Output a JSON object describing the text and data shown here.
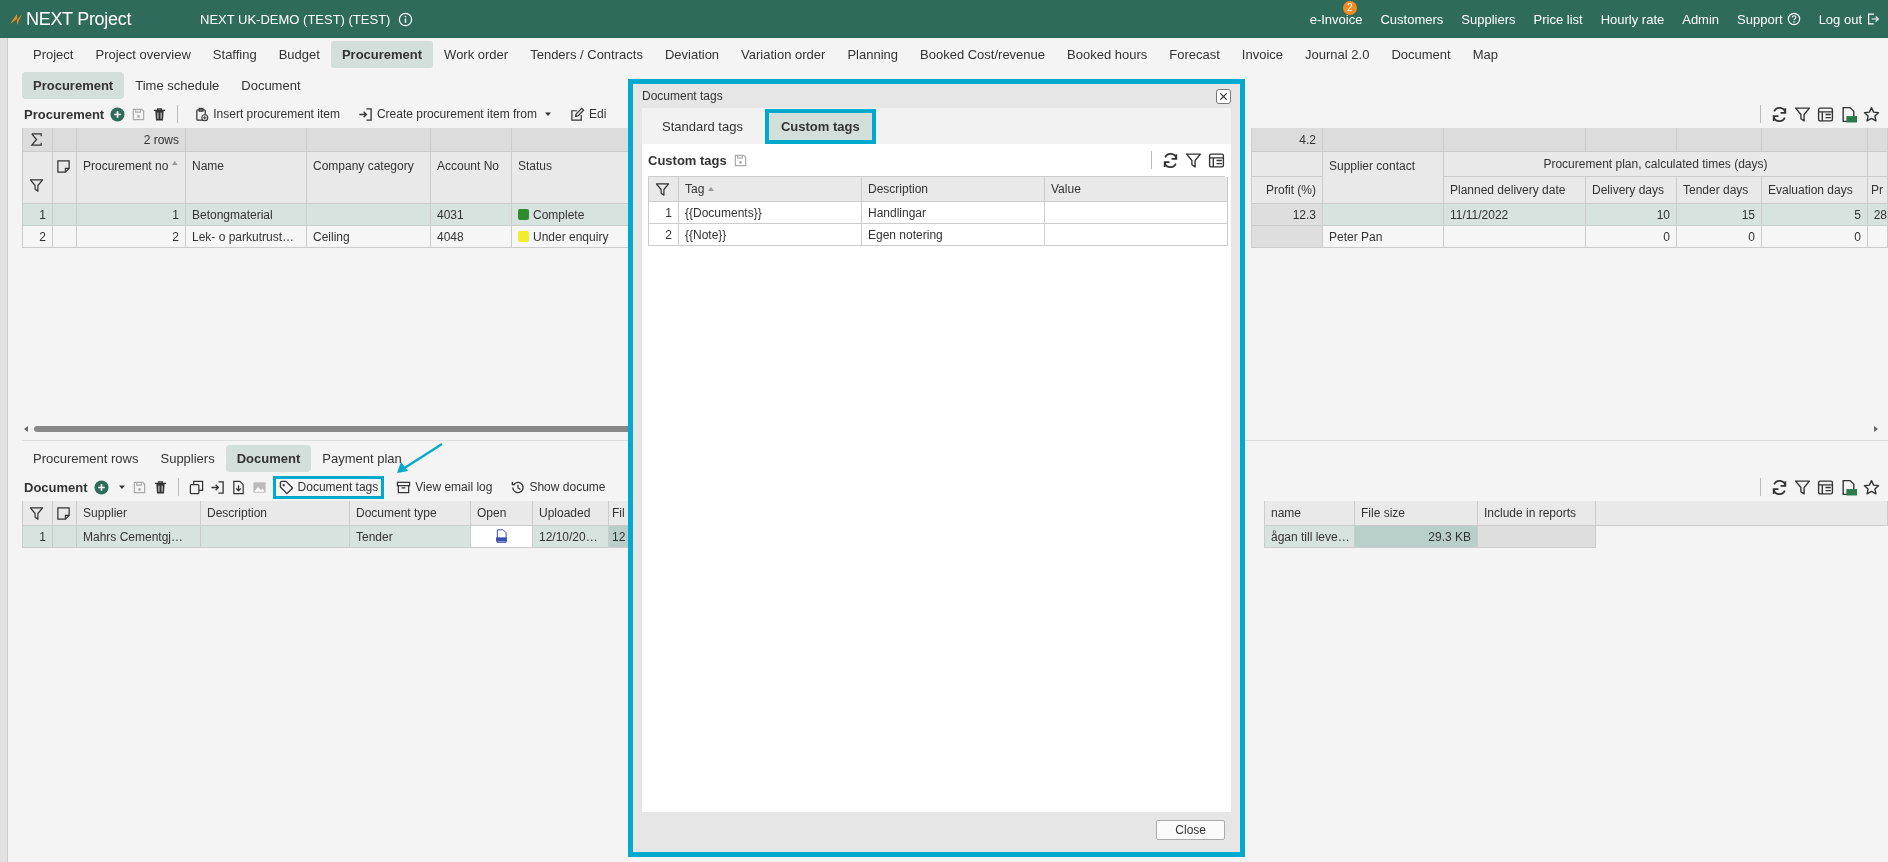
{
  "header": {
    "logo": "NEXT Project",
    "project": "NEXT UK-DEMO (TEST) (TEST)"
  },
  "top_nav": [
    {
      "label": "e-Invoice",
      "kind": "link",
      "badge": "2"
    },
    {
      "label": "Customers",
      "kind": "link"
    },
    {
      "label": "Suppliers",
      "kind": "link"
    },
    {
      "label": "Price list",
      "kind": "link"
    },
    {
      "label": "Hourly rate",
      "kind": "link"
    },
    {
      "label": "Admin",
      "kind": "link"
    },
    {
      "label": "Support",
      "kind": "help"
    },
    {
      "label": "Log out",
      "kind": "logout"
    }
  ],
  "main_tabs": [
    {
      "label": "Project",
      "selected": false
    },
    {
      "label": "Project overview",
      "selected": false
    },
    {
      "label": "Staffing",
      "selected": false
    },
    {
      "label": "Budget",
      "selected": false
    },
    {
      "label": "Procurement",
      "selected": true
    },
    {
      "label": "Work order",
      "selected": false
    },
    {
      "label": "Tenders / Contracts",
      "selected": false
    },
    {
      "label": "Deviation",
      "selected": false
    },
    {
      "label": "Variation order",
      "selected": false
    },
    {
      "label": "Planning",
      "selected": false
    },
    {
      "label": "Booked Cost/revenue",
      "selected": false
    },
    {
      "label": "Booked hours",
      "selected": false
    },
    {
      "label": "Forecast",
      "selected": false
    },
    {
      "label": "Invoice",
      "selected": false
    },
    {
      "label": "Journal 2.0",
      "selected": false
    },
    {
      "label": "Document",
      "selected": false
    },
    {
      "label": "Map",
      "selected": false
    }
  ],
  "sub_tabs": [
    {
      "label": "Procurement",
      "selected": true
    },
    {
      "label": "Time schedule",
      "selected": false
    },
    {
      "label": "Document",
      "selected": false
    }
  ],
  "procurement": {
    "title": "Procurement",
    "actions": [
      {
        "label": "Insert procurement item",
        "kind": "insert",
        "dropdown": false
      },
      {
        "label": "Create procurement item from",
        "kind": "create",
        "dropdown": true
      },
      {
        "label": "Edi",
        "kind": "edit",
        "dropdown": false
      }
    ]
  },
  "procurement_table": {
    "summary": "2 rows",
    "right_summary": "4.2",
    "columns": [
      {
        "label": "Procurement no",
        "sorted": true
      },
      {
        "label": "Name",
        "sorted": false
      },
      {
        "label": "Company category",
        "sorted": false
      },
      {
        "label": "Account No",
        "sorted": false
      },
      {
        "label": "Status",
        "sorted": false
      }
    ],
    "right_columns": {
      "column_1": "Profit (%)",
      "supplier_contact": "Supplier contact",
      "group": "Procurement plan, calculated times (days)",
      "group_columns": [
        "Planned delivery date",
        "Delivery days",
        "Tender days",
        "Evaluation days"
      ],
      "column_last": "Pr"
    },
    "rows": [
      {
        "no": "1",
        "selected": true,
        "cells": [
          "1",
          "Betongmaterial",
          "",
          "4031"
        ],
        "status": {
          "label": "Complete",
          "color": "#2e8b2e"
        },
        "right_cells": [
          "12.3",
          "",
          "11/11/2022",
          "10",
          "15",
          "5",
          "28"
        ]
      },
      {
        "no": "2",
        "selected": false,
        "cells": [
          "2",
          "Lek- o parkutrust…",
          "Ceiling",
          "4048"
        ],
        "status": {
          "label": "Under enquiry",
          "color": "#f2ec2e"
        },
        "right_cells": [
          "",
          "Peter Pan",
          "",
          "0",
          "0",
          "0",
          ""
        ]
      }
    ]
  },
  "bottom_tabs": [
    {
      "label": "Procurement rows",
      "selected": false
    },
    {
      "label": "Suppliers",
      "selected": false
    },
    {
      "label": "Document",
      "selected": true
    },
    {
      "label": "Payment plan",
      "selected": false
    }
  ],
  "document": {
    "title": "Document",
    "actions": [
      {
        "label": "Document tags",
        "kind": "tag",
        "highlighted": true
      },
      {
        "label": "View email log",
        "kind": "archive",
        "highlighted": false
      },
      {
        "label": "Show docume",
        "kind": "history",
        "highlighted": false
      }
    ]
  },
  "document_table": {
    "columns": [
      "Supplier",
      "Description",
      "Document type",
      "Open",
      "Uploaded",
      "Fil"
    ],
    "right_columns": [
      "name",
      "File size",
      "Include in reports"
    ],
    "rows": [
      {
        "no": "1",
        "selected": true,
        "cells": [
          "Mahrs Cementgj…",
          "",
          "Tender",
          "",
          "12/10/20…",
          "12"
        ],
        "right_cells": [
          "ågan till leve…",
          "29.3 KB",
          ""
        ]
      }
    ]
  },
  "dialog": {
    "title": "Document tags",
    "highlighted": true,
    "tabs": [
      {
        "label": "Standard tags",
        "selected": false,
        "highlighted": false
      },
      {
        "label": "Custom tags",
        "selected": true,
        "highlighted": true
      }
    ],
    "section": "Custom tags",
    "columns": [
      {
        "label": "Tag",
        "sorted": true
      },
      {
        "label": "Description",
        "sorted": false
      },
      {
        "label": "Value",
        "sorted": false
      }
    ],
    "rows": [
      {
        "no": "1",
        "cells": [
          "{{Documents}}",
          "Handlingar",
          ""
        ]
      },
      {
        "no": "2",
        "cells": [
          "{{Note}}",
          "Egen notering",
          ""
        ]
      }
    ],
    "close": "Close"
  }
}
